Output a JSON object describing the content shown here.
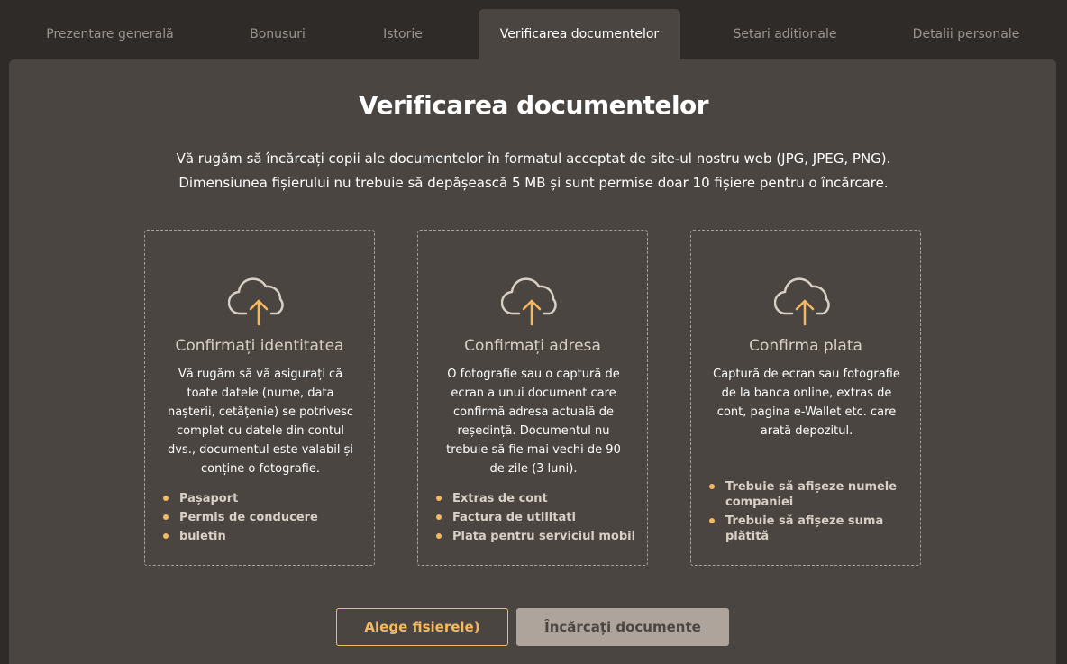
{
  "tabs": [
    {
      "label": "Prezentare generală"
    },
    {
      "label": "Bonusuri"
    },
    {
      "label": "Istorie"
    },
    {
      "label": "Verificarea documentelor"
    },
    {
      "label": "Setari aditionale"
    },
    {
      "label": "Detalii personale"
    }
  ],
  "active_tab": "Verificarea documentelor",
  "page": {
    "title": "Verificarea documentelor",
    "description_line1": "Vă rugăm să încărcați copii ale documentelor în formatul acceptat de site-ul nostru web (JPG, JPEG, PNG).",
    "description_line2": "Dimensiunea fișierului nu trebuie să depășească 5 MB și sunt permise doar 10 fișiere pentru o încărcare."
  },
  "cards": [
    {
      "icon": "cloud-upload-icon",
      "title": "Confirmați identitatea",
      "text": "Vă rugăm să vă asigurați că toate datele (nume, data nașterii, cetățenie) se potrivesc complet cu datele din contul dvs., documentul este valabil și conține o fotografie.",
      "items": [
        "Pașaport",
        "Permis de conducere",
        "buletin"
      ]
    },
    {
      "icon": "cloud-upload-icon",
      "title": "Confirmați adresa",
      "text": "O fotografie sau o captură de ecran a unui document care confirmă adresa actuală de reședință. Documentul nu trebuie să fie mai vechi de 90 de zile (3 luni).",
      "items": [
        "Extras de cont",
        "Factura de utilitati",
        "Plata pentru serviciul mobil"
      ]
    },
    {
      "icon": "cloud-upload-icon",
      "title": "Confirma plata",
      "text": "Captură de ecran sau fotografie de la banca online, extras de cont, pagina e-Wallet etc. care arată depozitul.",
      "items": [
        "Trebuie să afișeze numele companiei",
        "Trebuie să afișeze suma plătită"
      ]
    }
  ],
  "buttons": {
    "choose_files": "Alege fisierele)",
    "upload": "Încărcați documente"
  },
  "colors": {
    "accent": "#f5b962",
    "panel": "#4a4540",
    "background": "#2f2b28"
  }
}
